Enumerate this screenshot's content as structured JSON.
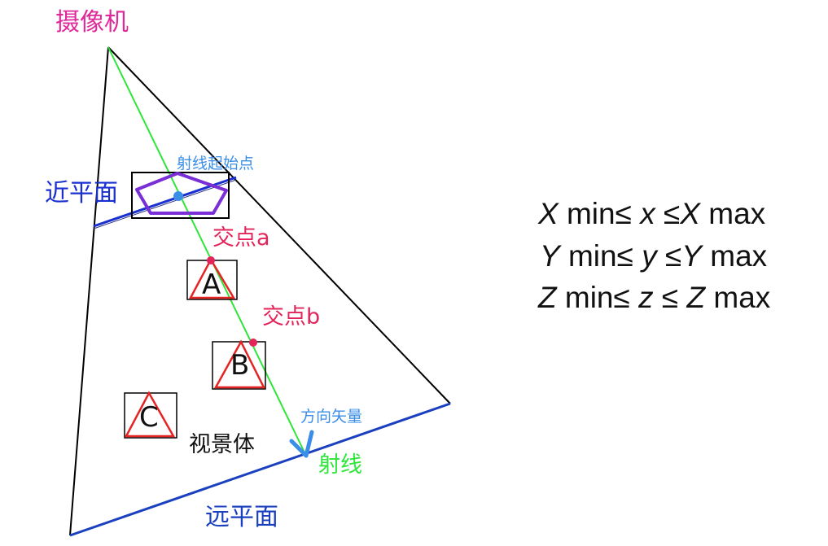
{
  "colors": {
    "camera": "#e0289b",
    "near_plane": "#1a2fd0",
    "far_plane": "#1a3fbf",
    "ray": "#2ee63a",
    "frustum_edge": "#000000",
    "pentagon": "#7a2fd6",
    "start_point": "#3a8ee8",
    "intersection": "#e3245a",
    "direction": "#3a8ee8",
    "triangle": "#e62323",
    "box": "#000000"
  },
  "labels": {
    "camera": "摄像机",
    "near_plane": "近平面",
    "far_plane": "远平面",
    "ray_start": "射线起始点",
    "intersection_a": "交点a",
    "intersection_b": "交点b",
    "frustum": "视景体",
    "direction_vector": "方向矢量",
    "ray": "射线"
  },
  "objects": [
    {
      "name": "object-a",
      "letter": "A"
    },
    {
      "name": "object-b",
      "letter": "B"
    },
    {
      "name": "object-c",
      "letter": "C"
    }
  ],
  "equations": [
    {
      "var_upper": "X",
      "var_lower": "x"
    },
    {
      "var_upper": "Y",
      "var_lower": "y"
    },
    {
      "var_upper": "Z",
      "var_lower": "z"
    }
  ],
  "equation_text": {
    "min_le": " min≤ ",
    "le": " ≤",
    "le_spaced": " ≤ ",
    "max": " max"
  }
}
